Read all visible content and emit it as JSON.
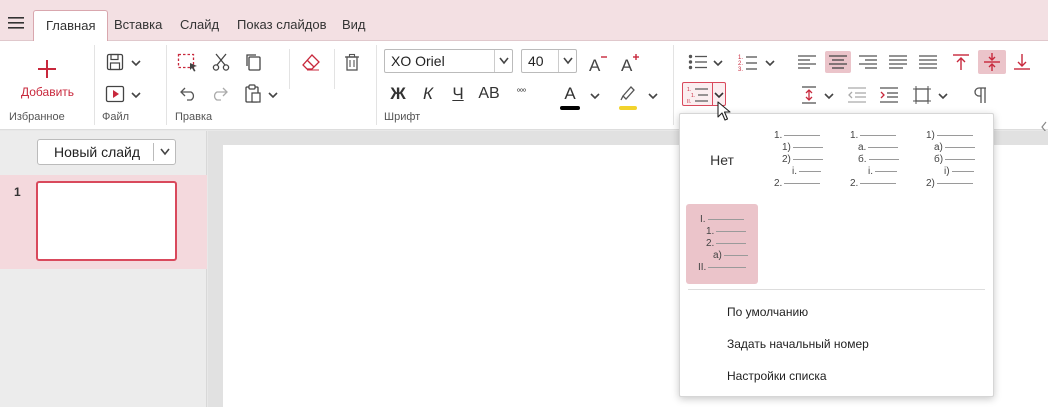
{
  "tabs": [
    {
      "label": "Главная",
      "active": true
    },
    {
      "label": "Вставка"
    },
    {
      "label": "Слайд"
    },
    {
      "label": "Показ слайдов"
    },
    {
      "label": "Вид"
    }
  ],
  "ribbon": {
    "favorites": {
      "add_label": "Добавить",
      "group_label": "Избранное"
    },
    "file": {
      "group_label": "Файл"
    },
    "edit": {
      "group_label": "Правка"
    },
    "font": {
      "group_label": "Шрифт",
      "font_name": "XO Oriel",
      "font_size": "40",
      "bold": "Ж",
      "italic": "К",
      "underline": "Ч",
      "caps": "AB",
      "more": "°°°",
      "font_color_letter": "A",
      "font_color": "#000000",
      "highlight_color": "#f2d32c"
    }
  },
  "sidebar": {
    "new_slide_label": "Новый слайд",
    "slides": [
      {
        "number": "1"
      }
    ]
  },
  "numbering_popup": {
    "none_label": "Нет",
    "styles": [
      {
        "id": "numeric-nested",
        "levels": [
          {
            "t": "1."
          },
          {
            "t": "1)"
          },
          {
            "t": "2)"
          },
          {
            "t": "i."
          },
          {
            "t": "2."
          }
        ]
      },
      {
        "id": "numeric-letter-roman",
        "levels": [
          {
            "t": "1."
          },
          {
            "t": "а."
          },
          {
            "t": "б."
          },
          {
            "t": "i."
          },
          {
            "t": "2."
          }
        ]
      },
      {
        "id": "paren-letter-roman",
        "levels": [
          {
            "t": "1)"
          },
          {
            "t": "а)"
          },
          {
            "t": "б)"
          },
          {
            "t": "i)"
          },
          {
            "t": "2)"
          }
        ]
      },
      {
        "id": "roman-numeric-letter",
        "selected": true,
        "levels": [
          {
            "t": "I."
          },
          {
            "t": "1."
          },
          {
            "t": "2."
          },
          {
            "t": "а)"
          },
          {
            "t": "II."
          }
        ]
      }
    ],
    "menu": {
      "default": "По умолчанию",
      "set_start": "Задать начальный номер",
      "settings": "Настройки списка"
    }
  },
  "colors": {
    "accent": "#c8283c",
    "tab_bar_bg": "#f3e0e3",
    "selected_cell_bg": "#ebc4ca"
  }
}
